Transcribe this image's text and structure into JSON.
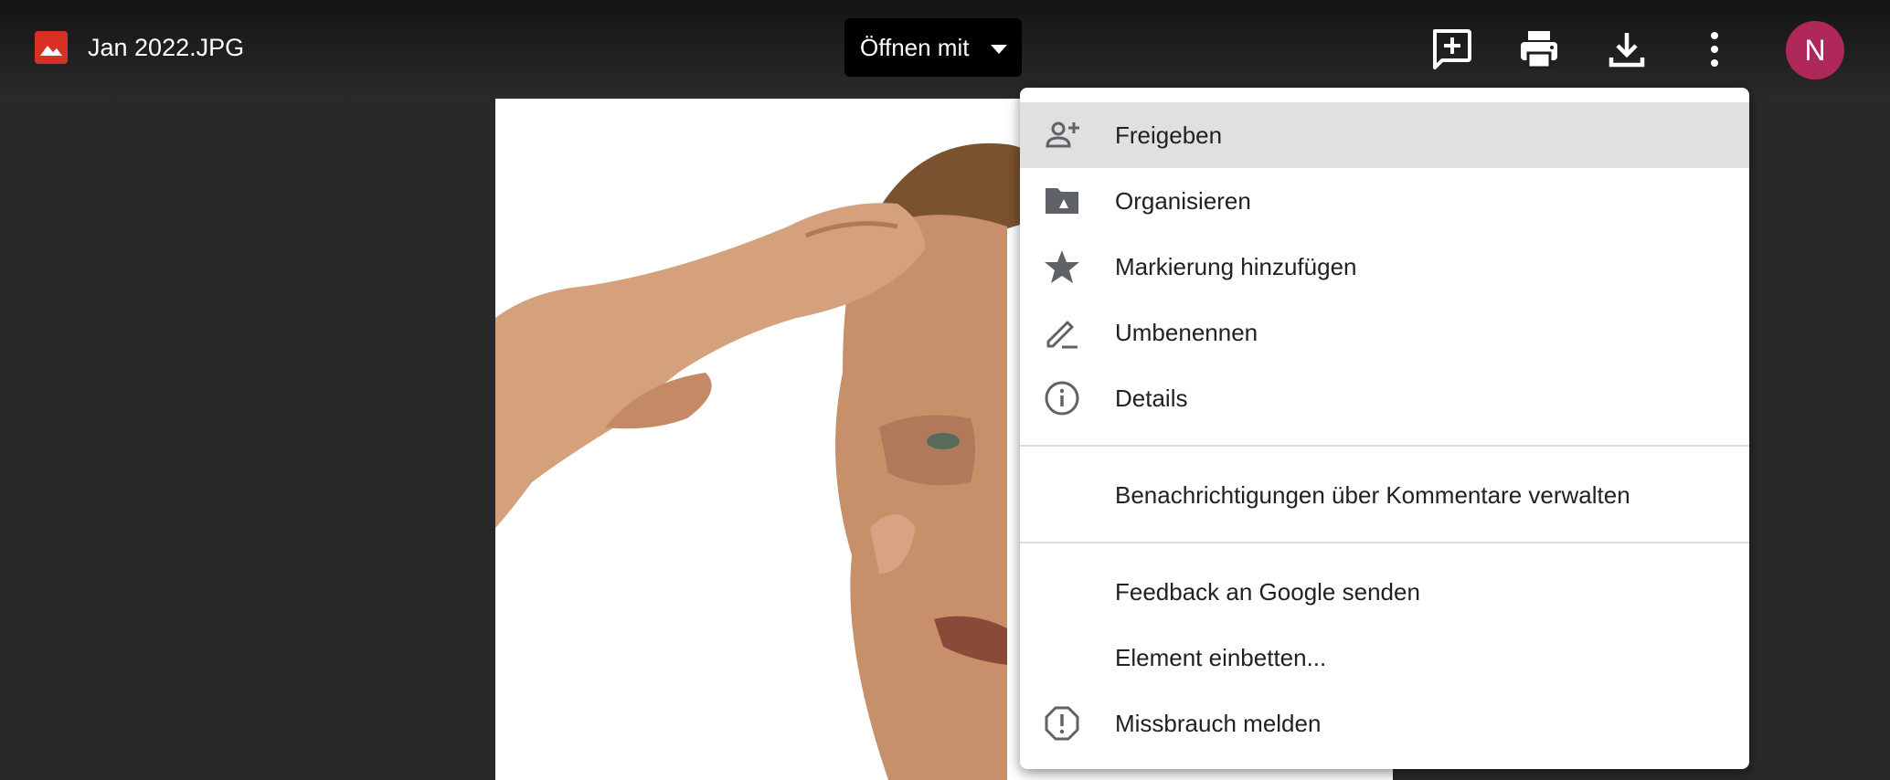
{
  "file": {
    "name": "Jan 2022.JPG",
    "icon": "image-file-icon",
    "icon_color": "#d93025"
  },
  "toolbar": {
    "open_with_label": "Öffnen mit",
    "add_comment_icon": "add-comment-icon",
    "print_icon": "print-icon",
    "download_icon": "download-icon",
    "more_icon": "more-vert-icon"
  },
  "account": {
    "initial": "N",
    "color": "#b0285a"
  },
  "menu": {
    "items": [
      {
        "label": "Freigeben",
        "icon": "person-add-icon",
        "active": true
      },
      {
        "label": "Organisieren",
        "icon": "drive-folder-icon"
      },
      {
        "label": "Markierung hinzufügen",
        "icon": "star-icon"
      },
      {
        "label": "Umbenennen",
        "icon": "rename-pen-icon"
      },
      {
        "label": "Details",
        "icon": "info-icon"
      },
      {
        "label": "Benachrichtigungen über Kommentare verwalten"
      },
      {
        "label": "Feedback an Google senden"
      },
      {
        "label": "Element einbetten..."
      },
      {
        "label": "Missbrauch melden",
        "icon": "report-icon"
      }
    ]
  },
  "colors": {
    "background": "#292929",
    "menu_highlight": "#e0e0e0",
    "icon_gray": "#5f6368"
  }
}
